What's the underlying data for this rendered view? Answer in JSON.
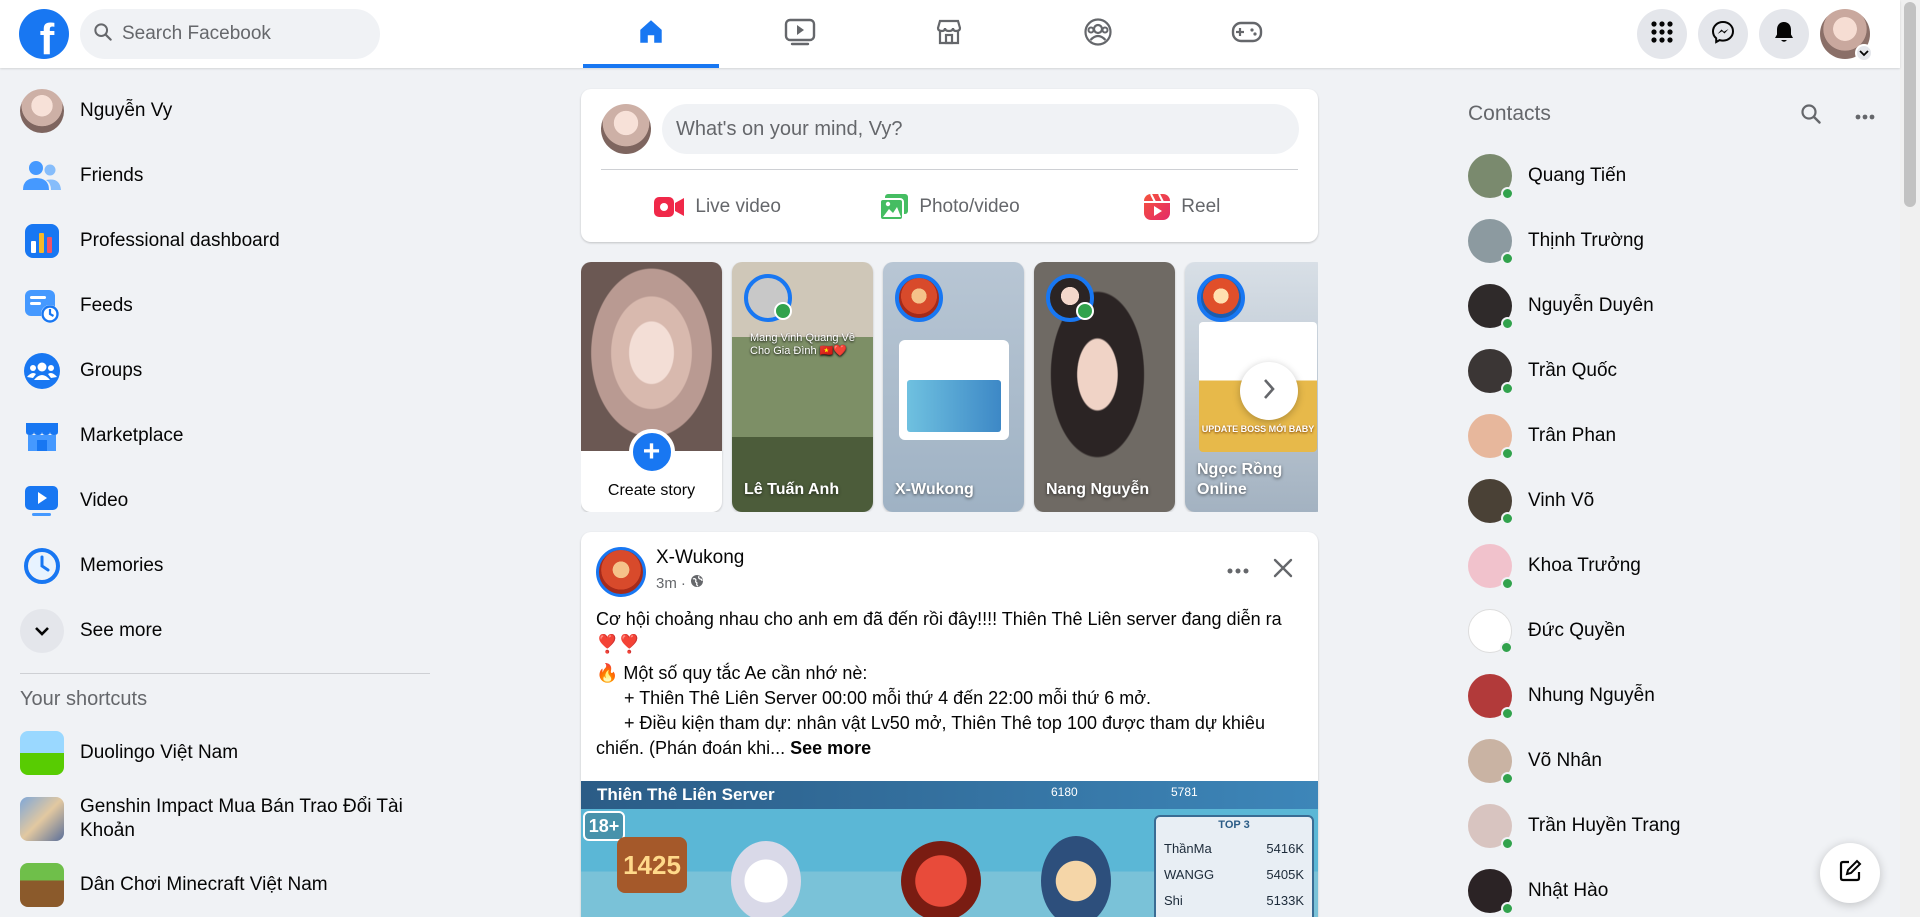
{
  "header": {
    "logo_letter": "f",
    "search_placeholder": "Search Facebook",
    "nav_tabs": [
      {
        "icon": "home-icon",
        "active": true
      },
      {
        "icon": "video-icon",
        "active": false
      },
      {
        "icon": "marketplace-icon",
        "active": false
      },
      {
        "icon": "groups-icon",
        "active": false
      },
      {
        "icon": "gaming-icon",
        "active": false
      }
    ],
    "right_buttons": [
      "menu-grid-icon",
      "messenger-icon",
      "notifications-icon"
    ],
    "accent_color": "#1877f2"
  },
  "left_sidebar": {
    "items": [
      {
        "label": "Nguyễn Vy",
        "icon": "avatar"
      },
      {
        "label": "Friends",
        "icon": "friends-icon"
      },
      {
        "label": "Professional dashboard",
        "icon": "dashboard-icon"
      },
      {
        "label": "Feeds",
        "icon": "feeds-icon"
      },
      {
        "label": "Groups",
        "icon": "groups-icon"
      },
      {
        "label": "Marketplace",
        "icon": "marketplace-icon"
      },
      {
        "label": "Video",
        "icon": "video-icon"
      },
      {
        "label": "Memories",
        "icon": "memories-icon"
      },
      {
        "label": "See more",
        "icon": "chevron-down-icon"
      }
    ],
    "shortcuts_title": "Your shortcuts",
    "shortcuts": [
      {
        "label": "Duolingo Việt Nam"
      },
      {
        "label": "Genshin Impact Mua Bán Trao Đổi Tài Khoản"
      },
      {
        "label": "Dân Chơi Minecraft Việt Nam"
      }
    ]
  },
  "composer": {
    "placeholder": "What's on your mind, Vy?",
    "actions": [
      {
        "label": "Live video",
        "icon": "live-video-icon",
        "color": "#f02849"
      },
      {
        "label": "Photo/video",
        "icon": "photo-icon",
        "color": "#45bd62"
      },
      {
        "label": "Reel",
        "icon": "reel-icon",
        "color": "#e42645"
      }
    ]
  },
  "stories": {
    "create_label": "Create story",
    "items": [
      {
        "name": "Lê Tuấn Anh",
        "overlay_text": "Mang Vinh Quang Về Cho Gia Đình 🇻🇳❤️",
        "online": true
      },
      {
        "name": "X-Wukong",
        "overlay_text": "X-Wukong",
        "online": false
      },
      {
        "name": "Nang Nguyễn",
        "overlay_text": "",
        "online": true
      },
      {
        "name": "Ngọc Rồng Online",
        "overlay_text": "UPDATE BOSS MỚI BABY",
        "online": false
      }
    ]
  },
  "post": {
    "author": "X-Wukong",
    "time": "3m",
    "lines": [
      "Cơ hội choảng nhau cho anh em đã đến rồi đây!!!! Thiên Thê Liên server đang diễn ra ❣️❣️",
      "🔥 Một số quy tắc Ae cần nhớ nè:",
      "+ Thiên Thê Liên Server 00:00 mỗi thứ 4 đến 22:00 mỗi thứ 6 mở.",
      "+ Điều kiện tham dự: nhân vật Lv50 mở, Thiên Thê top 100 được tham dự khiêu chiến. (Phán đoán khi..."
    ],
    "see_more": "See more",
    "image": {
      "title": "Thiên Thê Liên Server",
      "age_badge": "18+",
      "rank_number": "1425",
      "stats": [
        "6180",
        "5781"
      ],
      "top_label": "TOP 3",
      "top_rows": [
        {
          "name": "ThầnMa",
          "score": "5416K"
        },
        {
          "name": "WANGG",
          "score": "5405K"
        },
        {
          "name": "Shi",
          "score": "5133K"
        }
      ]
    }
  },
  "contacts": {
    "title": "Contacts",
    "items": [
      {
        "name": "Quang Tiến",
        "color": "#7a8a6e"
      },
      {
        "name": "Thịnh Trường",
        "color": "#8c9aa0"
      },
      {
        "name": "Nguyễn Duyên",
        "color": "#2f2a2a"
      },
      {
        "name": "Trần Quốc",
        "color": "#3b3635"
      },
      {
        "name": "Trân Phan",
        "color": "#e7b79c"
      },
      {
        "name": "Vinh Võ",
        "color": "#4a4136"
      },
      {
        "name": "Khoa Trưởng",
        "color": "#f1c2cc"
      },
      {
        "name": "Đức Quyền",
        "color": "#ffffff"
      },
      {
        "name": "Nhung Nguyễn",
        "color": "#b23a3a"
      },
      {
        "name": "Võ Nhân",
        "color": "#c9b3a3"
      },
      {
        "name": "Trần Huyền Trang",
        "color": "#d8c4c0"
      },
      {
        "name": "Nhật Hào",
        "color": "#2b2325"
      }
    ]
  }
}
